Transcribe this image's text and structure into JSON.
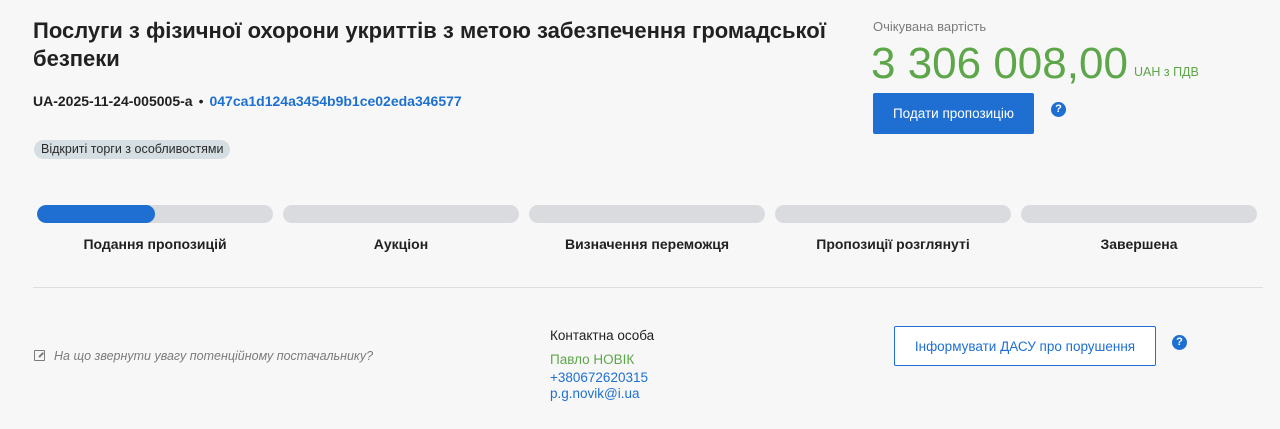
{
  "tender": {
    "title": "Послуги з фізичної охорони укриттів з метою забезпечення громадської безпеки",
    "id": "UA-2025-11-24-005005-a",
    "separator": "•",
    "hash": "047ca1d124a3454b9b1ce02eda346577",
    "procedure_badge": "Відкриті торги з особливостями"
  },
  "price": {
    "label": "Очікувана вартість",
    "amount": "3 306 008,00",
    "currency": "UAH з ПДВ"
  },
  "actions": {
    "submit_label": "Подати пропозицію",
    "help_symbol": "?",
    "report_label": "Інформувати ДАСУ про порушення"
  },
  "stages": [
    {
      "label": "Подання пропозицій",
      "progress": 0.5
    },
    {
      "label": "Аукціон",
      "progress": 0
    },
    {
      "label": "Визначення переможця",
      "progress": 0
    },
    {
      "label": "Пропозиції розглянуті",
      "progress": 0
    },
    {
      "label": "Завершена",
      "progress": 0
    }
  ],
  "hint": {
    "icon": "external-link-icon",
    "text": "На що звернути увагу потенційному постачальнику?"
  },
  "contact": {
    "title": "Контактна особа",
    "name": "Павло НОВІК",
    "phone": "+380672620315",
    "email": "p.g.novik@i.ua"
  },
  "colors": {
    "accent": "#1e6fd1",
    "price_green": "#5ea64a",
    "bar_bg": "#d9dbde"
  }
}
